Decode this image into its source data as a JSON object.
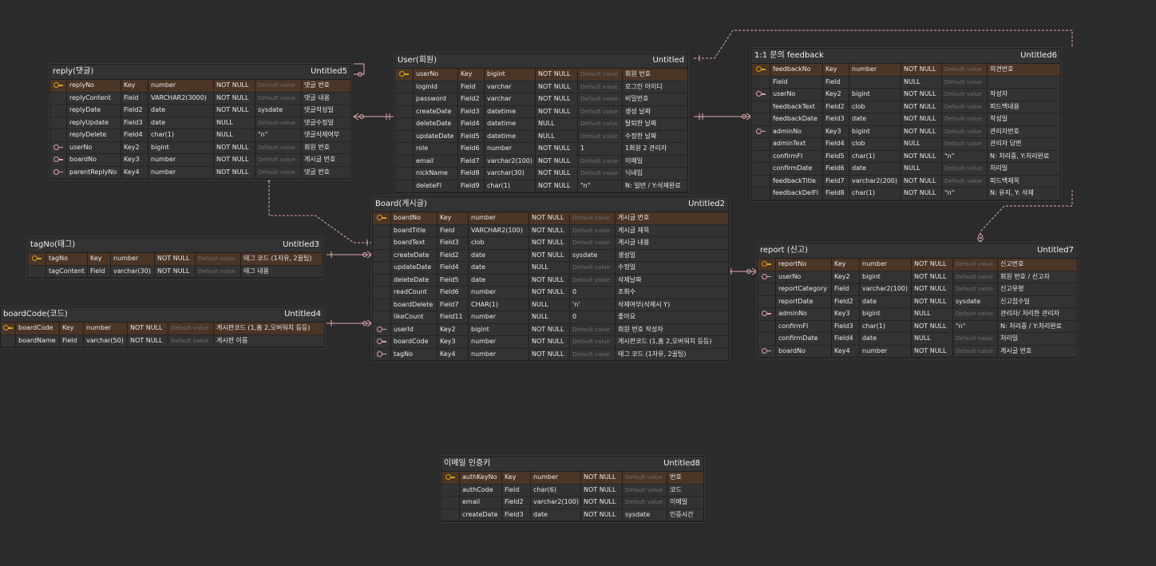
{
  "colors": {
    "background": "#2b2b2b",
    "entity_bg": "#333333",
    "pk_row": "#4a3527",
    "primary_key_icon": "#d4a017",
    "foreign_key_icon": "#d8a0a8",
    "relationship_line": "#e2a9b1"
  },
  "placeholder_default": "Default value",
  "entities": {
    "reply": {
      "title": "reply(댓글)",
      "dbname": "Untitled5",
      "rows": [
        {
          "icon": "pk",
          "name": "replyNo",
          "kind": "Key",
          "type": "number",
          "nn": "NOT NULL",
          "def": "",
          "cm": "댓글 번호"
        },
        {
          "icon": "",
          "name": "replyContent",
          "kind": "Field",
          "type": "VARCHAR2(3000)",
          "nn": "NOT NULL",
          "def": "",
          "cm": "댓글 내용"
        },
        {
          "icon": "",
          "name": "replyDate",
          "kind": "Field2",
          "type": "date",
          "nn": "NOT NULL",
          "def": "sysdate",
          "cm": "댓글작성일"
        },
        {
          "icon": "",
          "name": "replyUpdate",
          "kind": "Field3",
          "type": "date",
          "nn": "NULL",
          "def": "",
          "cm": "댓글수정일"
        },
        {
          "icon": "",
          "name": "replyDelete",
          "kind": "Field4",
          "type": "char(1)",
          "nn": "NULL",
          "def": "\"n\"",
          "cm": "댓글삭제여부"
        },
        {
          "icon": "fk",
          "name": "userNo",
          "kind": "Key2",
          "type": "bigint",
          "nn": "NOT NULL",
          "def": "",
          "cm": "회원 번호"
        },
        {
          "icon": "fk",
          "name": "boardNo",
          "kind": "Key3",
          "type": "number",
          "nn": "NOT NULL",
          "def": "",
          "cm": "게시글 번호"
        },
        {
          "icon": "fk",
          "name": "parentReplyNo",
          "kind": "Key4",
          "type": "number",
          "nn": "NOT NULL",
          "def": "",
          "cm": "댓글 번호"
        }
      ]
    },
    "user": {
      "title": "User(회원)",
      "dbname": "Untitled",
      "rows": [
        {
          "icon": "pk",
          "name": "userNo",
          "kind": "Key",
          "type": "bigint",
          "nn": "NOT NULL",
          "def": "",
          "cm": "회원 번호"
        },
        {
          "icon": "",
          "name": "loginId",
          "kind": "Field",
          "type": "varchar",
          "nn": "NOT NULL",
          "def": "",
          "cm": "로그인 아이디"
        },
        {
          "icon": "",
          "name": "password",
          "kind": "Field2",
          "type": "varchar",
          "nn": "NOT NULL",
          "def": "",
          "cm": "비밀번호"
        },
        {
          "icon": "",
          "name": "createDate",
          "kind": "Field3",
          "type": "datetime",
          "nn": "NOT NULL",
          "def": "",
          "cm": "생성 날짜"
        },
        {
          "icon": "",
          "name": "deleteDate",
          "kind": "Field4",
          "type": "datetime",
          "nn": "NULL",
          "def": "",
          "cm": "탈퇴한 날짜"
        },
        {
          "icon": "",
          "name": "updateDate",
          "kind": "Field5",
          "type": "datetime",
          "nn": "NULL",
          "def": "",
          "cm": "수정한 날짜"
        },
        {
          "icon": "",
          "name": "role",
          "kind": "Field6",
          "type": "number",
          "nn": "NOT NULL",
          "def": "1",
          "cm": "1회원 2 관리자"
        },
        {
          "icon": "",
          "name": "email",
          "kind": "Field7",
          "type": "varchar2(100)",
          "nn": "NOT NULL",
          "def": "",
          "cm": "이메일"
        },
        {
          "icon": "",
          "name": "nickName",
          "kind": "Field8",
          "type": "varchar(30)",
          "nn": "NOT NULL",
          "def": "",
          "cm": "닉네임"
        },
        {
          "icon": "",
          "name": "deleteFl",
          "kind": "Field9",
          "type": "char(1)",
          "nn": "NOT NULL",
          "def": "\"n\"",
          "cm": "N: 일반 / Y:삭제완료"
        }
      ]
    },
    "feedback": {
      "title": "1:1 문의 feedback",
      "dbname": "Untitled6",
      "rows": [
        {
          "icon": "pk",
          "name": "feedbackNo",
          "kind": "Key",
          "type": "number",
          "nn": "NOT NULL",
          "def": "",
          "cm": "의견번호"
        },
        {
          "icon": "",
          "name": "Field",
          "kind": "Field",
          "type": "",
          "nn": "NULL",
          "def": "",
          "cm": ""
        },
        {
          "icon": "fk",
          "name": "userNo",
          "kind": "Key2",
          "type": "bigint",
          "nn": "NOT NULL",
          "def": "",
          "cm": "작성자"
        },
        {
          "icon": "",
          "name": "feedbackText",
          "kind": "Field2",
          "type": "clob",
          "nn": "NOT NULL",
          "def": "",
          "cm": "피드백내용"
        },
        {
          "icon": "",
          "name": "feedbackDate",
          "kind": "Field3",
          "type": "date",
          "nn": "NOT NULL",
          "def": "",
          "cm": "작성일"
        },
        {
          "icon": "fk",
          "name": "adminNo",
          "kind": "Key3",
          "type": "bigint",
          "nn": "NOT NULL",
          "def": "",
          "cm": "관리자번호"
        },
        {
          "icon": "",
          "name": "adminText",
          "kind": "Field4",
          "type": "clob",
          "nn": "NULL",
          "def": "",
          "cm": "관리자 답변"
        },
        {
          "icon": "",
          "name": "confirmFl",
          "kind": "Field5",
          "type": "char(1)",
          "nn": "NOT NULL",
          "def": "\"n\"",
          "cm": "N: 처리중, Y:처리완료"
        },
        {
          "icon": "",
          "name": "confirmDate",
          "kind": "Field6",
          "type": "date",
          "nn": "NULL",
          "def": "",
          "cm": "처리일"
        },
        {
          "icon": "",
          "name": "feedbackTitle",
          "kind": "Field7",
          "type": "varchar2(200)",
          "nn": "NOT NULL",
          "def": "",
          "cm": "피드백제목"
        },
        {
          "icon": "",
          "name": "feedbackDelFl",
          "kind": "Field8",
          "type": "char(1)",
          "nn": "NOT NULL",
          "def": "\"n\"",
          "cm": "N: 유지, Y: 삭제"
        }
      ]
    },
    "board": {
      "title": "Board(게시글)",
      "dbname": "Untitled2",
      "rows": [
        {
          "icon": "pk",
          "name": "boardNo",
          "kind": "Key",
          "type": "number",
          "nn": "NOT NULL",
          "def": "",
          "cm": "게시글 번호"
        },
        {
          "icon": "",
          "name": "boardTitle",
          "kind": "Field",
          "type": "VARCHAR2(100)",
          "nn": "NOT NULL",
          "def": "",
          "cm": "게시글 제목"
        },
        {
          "icon": "",
          "name": "boardText",
          "kind": "Field3",
          "type": "clob",
          "nn": "NOT NULL",
          "def": "",
          "cm": "게시글 내용"
        },
        {
          "icon": "",
          "name": "createDate",
          "kind": "Field2",
          "type": "date",
          "nn": "NOT NULL",
          "def": "sysdate",
          "cm": "생성일"
        },
        {
          "icon": "",
          "name": "updateDate",
          "kind": "Field4",
          "type": "date",
          "nn": "NULL",
          "def": "",
          "cm": "수정일"
        },
        {
          "icon": "",
          "name": "deleteDate",
          "kind": "Field5",
          "type": "date",
          "nn": "NOT NULL",
          "def": "",
          "cm": "삭제날짜"
        },
        {
          "icon": "",
          "name": "readCount",
          "kind": "Field6",
          "type": "number",
          "nn": "NOT NULL",
          "def": "0",
          "cm": "조회수"
        },
        {
          "icon": "",
          "name": "boardDelete",
          "kind": "Field7",
          "type": "CHAR(1)",
          "nn": "NULL",
          "def": "'n'",
          "cm": "삭제여부(삭제시 Y)"
        },
        {
          "icon": "",
          "name": "likeCount",
          "kind": "Field11",
          "type": "number",
          "nn": "NULL",
          "def": "0",
          "cm": "좋아요"
        },
        {
          "icon": "fk",
          "name": "userId",
          "kind": "Key2",
          "type": "bigint",
          "nn": "NOT NULL",
          "def": "",
          "cm": "회원 번호 작성자"
        },
        {
          "icon": "fk",
          "name": "boardCode",
          "kind": "Key3",
          "type": "number",
          "nn": "NOT NULL",
          "def": "",
          "cm": "게시판코드 (1,홈 2,오버워치 등등)"
        },
        {
          "icon": "fk",
          "name": "tagNo",
          "kind": "Key4",
          "type": "number",
          "nn": "NOT NULL",
          "def": "",
          "cm": "태그 코드 (1자유, 2꿀팁)"
        }
      ]
    },
    "tag": {
      "title": "tagNo(태그)",
      "dbname": "Untitled3",
      "rows": [
        {
          "icon": "pk",
          "name": "tagNo",
          "kind": "Key",
          "type": "number",
          "nn": "NOT NULL",
          "def": "",
          "cm": "태그 코드 (1자유, 2꿀팁)"
        },
        {
          "icon": "",
          "name": "tagContent",
          "kind": "Field",
          "type": "varchar(30)",
          "nn": "NOT NULL",
          "def": "",
          "cm": "태그 내용"
        }
      ]
    },
    "boardcode": {
      "title": "boardCode(코드)",
      "dbname": "Untitled4",
      "rows": [
        {
          "icon": "pk",
          "name": "boardCode",
          "kind": "Key",
          "type": "number",
          "nn": "NOT NULL",
          "def": "",
          "cm": "게시판코드 (1,홈 2,오버워치 등등)"
        },
        {
          "icon": "",
          "name": "boardName",
          "kind": "Field",
          "type": "varchar(50)",
          "nn": "NOT NULL",
          "def": "",
          "cm": "게시판 이름"
        }
      ]
    },
    "report": {
      "title": "report (신고)",
      "dbname": "Untitled7",
      "rows": [
        {
          "icon": "pk",
          "name": "reportNo",
          "kind": "Key",
          "type": "number",
          "nn": "NOT NULL",
          "def": "",
          "cm": "신고번호"
        },
        {
          "icon": "fk",
          "name": "userNo",
          "kind": "Key2",
          "type": "bigint",
          "nn": "NOT NULL",
          "def": "",
          "cm": "회원 번호 / 신고자"
        },
        {
          "icon": "",
          "name": "reportCategory",
          "kind": "Field",
          "type": "varchar2(100)",
          "nn": "NOT NULL",
          "def": "",
          "cm": "신고유형"
        },
        {
          "icon": "",
          "name": "reportDate",
          "kind": "Field2",
          "type": "date",
          "nn": "NOT NULL",
          "def": "sysdate",
          "cm": "신고접수일"
        },
        {
          "icon": "fk",
          "name": "adminNo",
          "kind": "Key3",
          "type": "bigint",
          "nn": "NULL",
          "def": "",
          "cm": "관리자/ 처리한 관리자"
        },
        {
          "icon": "",
          "name": "confirmFl",
          "kind": "Field3",
          "type": "char(1)",
          "nn": "NOT NULL",
          "def": "\"n\"",
          "cm": "N: 처리중 / Y:처리완료"
        },
        {
          "icon": "",
          "name": "confirmDate",
          "kind": "Field4",
          "type": "date",
          "nn": "NULL",
          "def": "",
          "cm": "처리일"
        },
        {
          "icon": "fk",
          "name": "boardNo",
          "kind": "Key4",
          "type": "number",
          "nn": "NOT NULL",
          "def": "",
          "cm": "게시글 번호"
        }
      ]
    },
    "emailauth": {
      "title": "이메일 인증키",
      "dbname": "Untitled8",
      "rows": [
        {
          "icon": "pk",
          "name": "authKeyNo",
          "kind": "Key",
          "type": "number",
          "nn": "NOT NULL",
          "def": "",
          "cm": "번호"
        },
        {
          "icon": "",
          "name": "authCode",
          "kind": "Field",
          "type": "char(6)",
          "nn": "NOT NULL",
          "def": "",
          "cm": "코드"
        },
        {
          "icon": "",
          "name": "email",
          "kind": "Field2",
          "type": "varchar2(100)",
          "nn": "NOT NULL",
          "def": "",
          "cm": "이메일"
        },
        {
          "icon": "",
          "name": "createDate",
          "kind": "Field3",
          "type": "date",
          "nn": "NOT NULL",
          "def": "sysdate",
          "cm": "인증시간"
        }
      ]
    }
  }
}
